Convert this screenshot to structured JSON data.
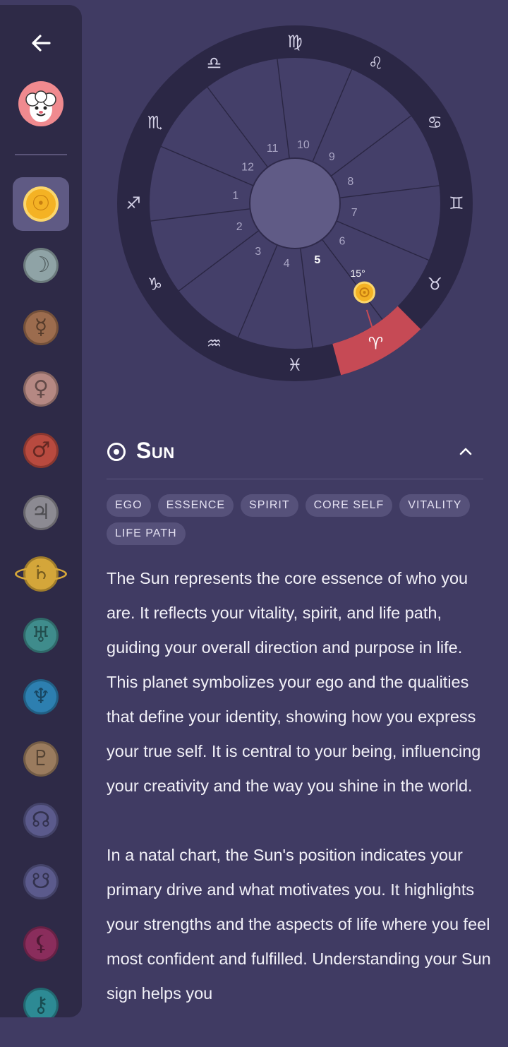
{
  "sidebar": {
    "back_icon": "arrow-left-icon",
    "avatar_icon": "ram-avatar",
    "planets": [
      {
        "name": "sun",
        "glyph": "☉",
        "color": "#f4b224",
        "selected": true
      },
      {
        "name": "moon",
        "glyph": "☽",
        "color": "#8fa3a6"
      },
      {
        "name": "mercury",
        "glyph": "☿",
        "color": "#9c6c4e"
      },
      {
        "name": "venus",
        "glyph": "♀",
        "color": "#b58883"
      },
      {
        "name": "mars",
        "glyph": "♂",
        "color": "#b84a3f"
      },
      {
        "name": "jupiter",
        "glyph": "♃",
        "color": "#8c8a92"
      },
      {
        "name": "saturn",
        "glyph": "♄",
        "color": "#d4a63a"
      },
      {
        "name": "uranus",
        "glyph": "♅",
        "color": "#3f8c8c"
      },
      {
        "name": "neptune",
        "glyph": "♆",
        "color": "#2d7fb0"
      },
      {
        "name": "pluto",
        "glyph": "♇",
        "color": "#9a7b5e"
      },
      {
        "name": "north-node",
        "glyph": "☊",
        "color": "#5b5a8c"
      },
      {
        "name": "south-node",
        "glyph": "☋",
        "color": "#5b5a8c"
      },
      {
        "name": "lilith",
        "glyph": "⚸",
        "color": "#8a2d5c"
      },
      {
        "name": "chiron",
        "glyph": "⚷",
        "color": "#2d8a94"
      }
    ]
  },
  "wheel": {
    "signs": [
      "♍",
      "♌",
      "♋",
      "♊",
      "♉",
      "♈",
      "♓",
      "♒",
      "♑",
      "♐",
      "♏",
      "♎"
    ],
    "houses": [
      "10",
      "9",
      "8",
      "7",
      "6",
      "5",
      "4",
      "3",
      "2",
      "1",
      "12",
      "11"
    ],
    "highlight_house": "5",
    "highlight_sign": "♈",
    "planet_degree": "15°",
    "accent": "#c64a55"
  },
  "planet": {
    "title": "Sun",
    "tags": [
      "EGO",
      "ESSENCE",
      "SPIRIT",
      "CORE SELF",
      "VITALITY",
      "LIFE PATH"
    ],
    "paragraphs": [
      "The Sun represents the core essence of who you are. It reflects your vitality, spirit, and life path, guiding your overall direction and purpose in life. This planet symbolizes your ego and the qualities that define your identity, showing how you express your true self. It is central to your being, influencing your creativity and the way you shine in the world.",
      "In a natal chart, the Sun's position indicates your primary drive and what motivates you. It highlights your strengths and the aspects of life where you feel most confident and fulfilled. Understanding your Sun sign helps you"
    ]
  }
}
